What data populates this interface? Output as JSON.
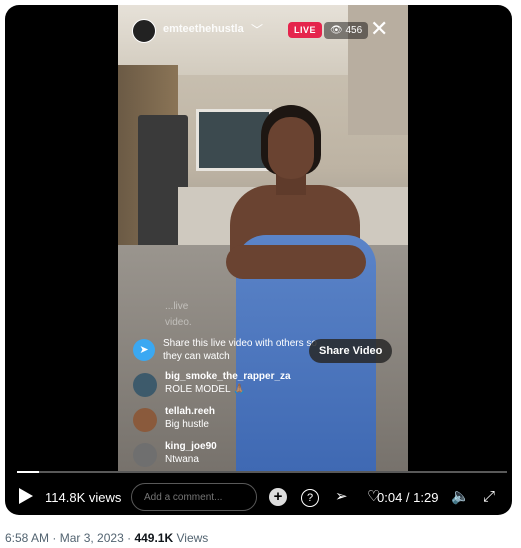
{
  "stream": {
    "username": "emteethehustla",
    "live_label": "LIVE",
    "viewer_count": "456"
  },
  "overlay": {
    "faded_line_1": "...live",
    "faded_line_2": "video.",
    "share_prompt": "Share this live video with others so they can watch",
    "share_button": "Share Video"
  },
  "comments": [
    {
      "user": "big_smoke_the_rapper_za",
      "text": "ROLE MODEL 🙏🏽"
    },
    {
      "user": "tellah.reeh",
      "text": "Big hustle"
    },
    {
      "user": "king_joe90",
      "text": "Ntwana"
    }
  ],
  "player": {
    "views": "114.8K views",
    "comment_placeholder": "Add a comment...",
    "time": "0:04 / 1:29",
    "progress": 0.045
  },
  "post_meta": {
    "time": "6:58 AM",
    "date": "Mar 3, 2023",
    "views_count": "449.1K",
    "views_label": "Views"
  },
  "icons": [
    "play-icon",
    "plus-icon",
    "question-icon",
    "send-icon",
    "heart-icon",
    "volume-icon",
    "expand-icon",
    "close-icon",
    "eye-icon",
    "share-icon"
  ]
}
